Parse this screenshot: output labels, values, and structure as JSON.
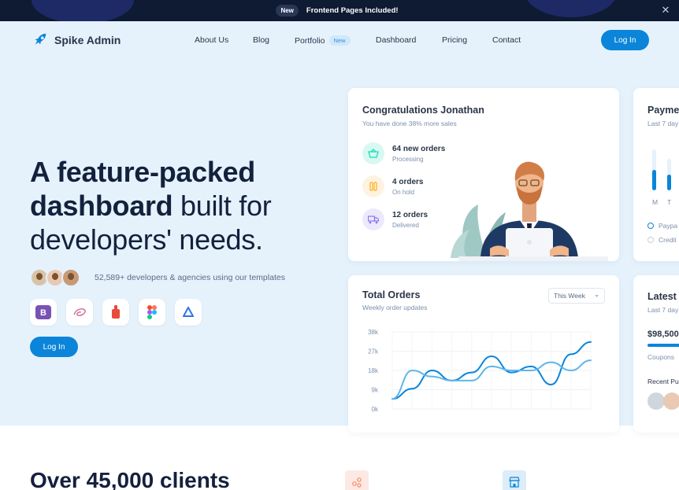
{
  "announcement": {
    "badge": "New",
    "message": "Frontend Pages Included!",
    "close_icon": "close-icon"
  },
  "brand": {
    "name": "Spike Admin",
    "logo_icon": "rocket-icon",
    "accent": "#0a85d9"
  },
  "nav": {
    "items": [
      {
        "label": "About Us"
      },
      {
        "label": "Blog"
      },
      {
        "label": "Portfolio",
        "badge": "New"
      },
      {
        "label": "Dashboard"
      },
      {
        "label": "Pricing"
      },
      {
        "label": "Contact"
      }
    ],
    "login": "Log In"
  },
  "hero": {
    "headline_bold_1": "A feature-packed",
    "headline_bold_2": "dashboard",
    "headline_rest_2": " built for",
    "headline_line_3": "developers' needs.",
    "developers_text": "52,589+ developers & agencies using our templates",
    "tools": [
      "bootstrap-icon",
      "sass-icon",
      "redux-icon",
      "figma-icon",
      "arco-icon"
    ],
    "login": "Log In"
  },
  "congrats_card": {
    "title": "Congratulations Jonathan",
    "subtitle": "You have done 38% more sales",
    "stats": [
      {
        "label": "64 new orders",
        "status": "Processing",
        "icon": "basket-icon",
        "color": "#13deb9"
      },
      {
        "label": "4 orders",
        "status": "On hold",
        "icon": "pause-icon",
        "color": "#ffae1f"
      },
      {
        "label": "12 orders",
        "status": "Delivered",
        "icon": "truck-icon",
        "color": "#8a73f5"
      }
    ]
  },
  "orders_card": {
    "title": "Total Orders",
    "subtitle": "Weekly order updates",
    "filter": "This Week",
    "y_ticks": [
      "38k",
      "27k",
      "18k",
      "9k",
      "0k"
    ]
  },
  "payments_card": {
    "title": "Payme",
    "subtitle": "Last 7 day",
    "x_labels": [
      "M",
      "T"
    ],
    "legend": [
      "Paypa",
      "Credit"
    ]
  },
  "latest_card": {
    "title": "Latest",
    "subtitle": "Last 7 day",
    "amount": "$98,500",
    "coupons": "Coupons",
    "recent": "Recent Pu"
  },
  "bottom": {
    "title": "Over 45,000 clients"
  },
  "chart_data": {
    "type": "line",
    "x": [
      0,
      1,
      2,
      3,
      4,
      5,
      6,
      7,
      8,
      9,
      10
    ],
    "ylim": [
      0,
      38
    ],
    "yticks": [
      "38k",
      "27k",
      "18k",
      "9k",
      "0k"
    ],
    "grid": true,
    "series": [
      {
        "values": [
          5,
          10,
          19,
          14,
          18,
          26,
          18,
          21,
          12,
          27,
          33
        ],
        "color": "#0a85d9"
      },
      {
        "values": [
          5,
          19,
          16,
          14,
          14,
          21,
          19,
          19,
          23,
          19,
          24
        ],
        "color": "#5db6eb"
      }
    ]
  }
}
